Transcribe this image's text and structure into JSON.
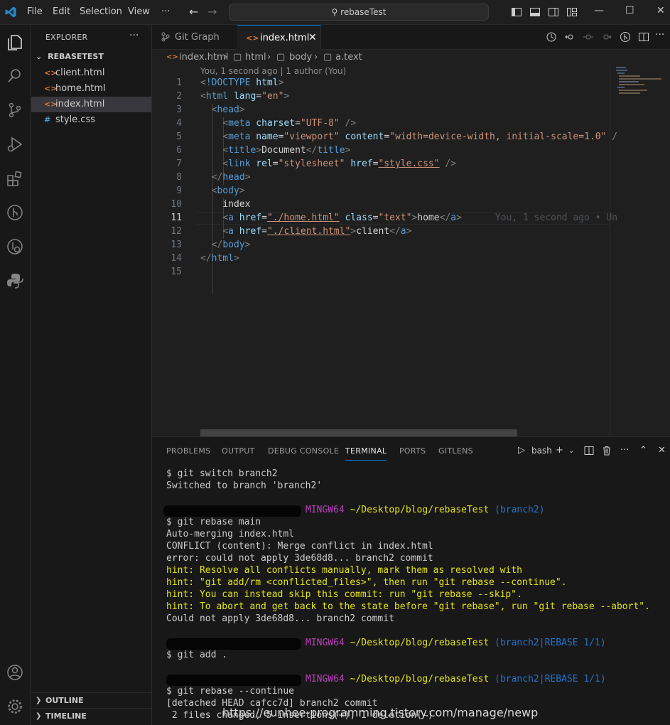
{
  "titlebar": {
    "menu": [
      "File",
      "Edit",
      "Selection",
      "View",
      "···"
    ],
    "search_text": "rebaseTest",
    "window_controls": [
      "minimize",
      "maximize",
      "close"
    ]
  },
  "sidebar": {
    "title": "EXPLORER",
    "more": "···",
    "folder": "REBASETEST",
    "files": [
      {
        "icon": "html-file-icon",
        "name": "client.html"
      },
      {
        "icon": "html-file-icon",
        "name": "home.html"
      },
      {
        "icon": "html-file-icon",
        "name": "index.html"
      },
      {
        "icon": "css-file-icon",
        "name": "style.css"
      }
    ],
    "selected": "index.html",
    "outline": "OUTLINE",
    "timeline": "TIMELINE"
  },
  "tabs": [
    {
      "label": "Git Graph",
      "icon": "git-graph-icon"
    },
    {
      "label": "index.html",
      "icon": "html-file-icon",
      "active": true
    }
  ],
  "breadcrumb": [
    "index.html",
    "html",
    "body",
    "a.text"
  ],
  "editor": {
    "blame_header": "You, 1 second ago | 1 author (You)",
    "current_line": 11,
    "inline_blame": "You, 1 second ago • Un",
    "line_numbers": [
      "1",
      "2",
      "3",
      "4",
      "5",
      "6",
      "7",
      "8",
      "9",
      "10",
      "11",
      "12",
      "13",
      "14",
      "15"
    ]
  },
  "panel": {
    "tabs": [
      "PROBLEMS",
      "OUTPUT",
      "DEBUG CONSOLE",
      "TERMINAL",
      "PORTS",
      "GITLENS"
    ],
    "active_tab": "TERMINAL",
    "shell": "bash",
    "terminal": {
      "l1": "$ git switch branch2",
      "l2": "Switched to branch 'branch2'",
      "p1_host": "MINGW64",
      "p1_path": "~/Desktop/blog/rebaseTest",
      "p1_branch": "(branch2)",
      "l3": "$ git rebase main",
      "l4": "Auto-merging index.html",
      "l5": "CONFLICT (content): Merge conflict in index.html",
      "l6": "error: could not apply 3de68d8... branch2 commit",
      "h1": "hint: Resolve all conflicts manually, mark them as resolved with",
      "h2": "hint: \"git add/rm <conflicted_files>\", then run \"git rebase --continue\".",
      "h3": "hint: You can instead skip this commit: run \"git rebase --skip\".",
      "h4": "hint: To abort and get back to the state before \"git rebase\", run \"git rebase --abort\".",
      "l7": "Could not apply 3de68d8... branch2 commit",
      "p2_host": "MINGW64",
      "p2_path": "~/Desktop/blog/rebaseTest",
      "p2_branch": "(branch2|REBASE 1/1)",
      "l8": "$ git add .",
      "p3_host": "MINGW64",
      "p3_path": "~/Desktop/blog/rebaseTest",
      "p3_branch": "(branch2|REBASE 1/1)",
      "l9": "$ git rebase --continue",
      "l10": "[detached HEAD cafcc7d] branch2 commit",
      "l11": " 2 files changed, 5 insertions(+), 1 deletion(-)"
    }
  },
  "watermark": "https://eunhee-programming.tistory.com/manage/newp",
  "colors": {
    "accent": "#0078d4",
    "html_icon": "#e37933",
    "css_icon": "#519aba",
    "hint": "#e5e510",
    "prompt_host": "#bc3fbc",
    "prompt_branch": "#2472c8"
  }
}
